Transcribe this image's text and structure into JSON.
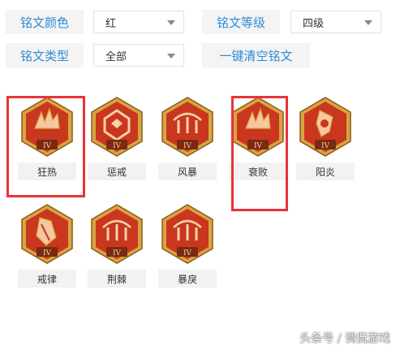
{
  "filters": {
    "color": {
      "label": "铭文颜色",
      "value": "红"
    },
    "level": {
      "label": "铭文等级",
      "value": "四级"
    },
    "type": {
      "label": "铭文类型",
      "value": "全部"
    },
    "clear_button": "一键清空铭文"
  },
  "runes": [
    {
      "name": "狂热",
      "level": "IV",
      "icon": "flame-rune-icon"
    },
    {
      "name": "惩戒",
      "level": "IV",
      "icon": "cube-rune-icon"
    },
    {
      "name": "风暴",
      "level": "IV",
      "icon": "gate-rune-icon"
    },
    {
      "name": "衰败",
      "level": "IV",
      "icon": "flame-rune-icon"
    },
    {
      "name": "阳炎",
      "level": "IV",
      "icon": "sun-rune-icon"
    },
    {
      "name": "戒律",
      "level": "IV",
      "icon": "crystal-rune-icon"
    },
    {
      "name": "荆棘",
      "level": "IV",
      "icon": "gate-rune-icon"
    },
    {
      "name": "暴戾",
      "level": "IV",
      "icon": "gate-rune-icon"
    }
  ],
  "watermark": "头条号 / 调侃游戏",
  "colors": {
    "accent": "#2d8cd6",
    "highlight": "#e8333a",
    "rune_red": "#c8371e",
    "rune_gold": "#d9a441"
  }
}
